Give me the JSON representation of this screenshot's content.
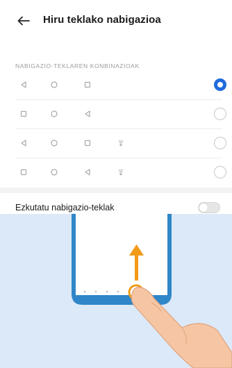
{
  "header": {
    "back_icon": "arrow-left-icon",
    "title": "Hiru teklako nabigazioa"
  },
  "combinations": {
    "section_label": "NABIGAZIO-TEKLAREN KONBINAZIOAK",
    "rows": [
      {
        "keys": [
          "back-triangle-icon",
          "home-circle-icon",
          "recent-square-icon"
        ],
        "selected": true
      },
      {
        "keys": [
          "recent-square-icon",
          "home-circle-icon",
          "back-triangle-icon"
        ],
        "selected": false
      },
      {
        "keys": [
          "back-triangle-icon",
          "home-circle-icon",
          "recent-square-icon",
          "notification-icon"
        ],
        "selected": false
      },
      {
        "keys": [
          "recent-square-icon",
          "home-circle-icon",
          "back-triangle-icon",
          "notification-icon"
        ],
        "selected": false
      }
    ]
  },
  "hide_keys": {
    "label": "Ezkutatu nabigazio-teklak",
    "enabled": false
  },
  "colors": {
    "accent": "#1f6bdc",
    "illustration_bg": "#dce9f8",
    "phone_frame": "#2f86c9",
    "arrow": "#f29a1a"
  }
}
